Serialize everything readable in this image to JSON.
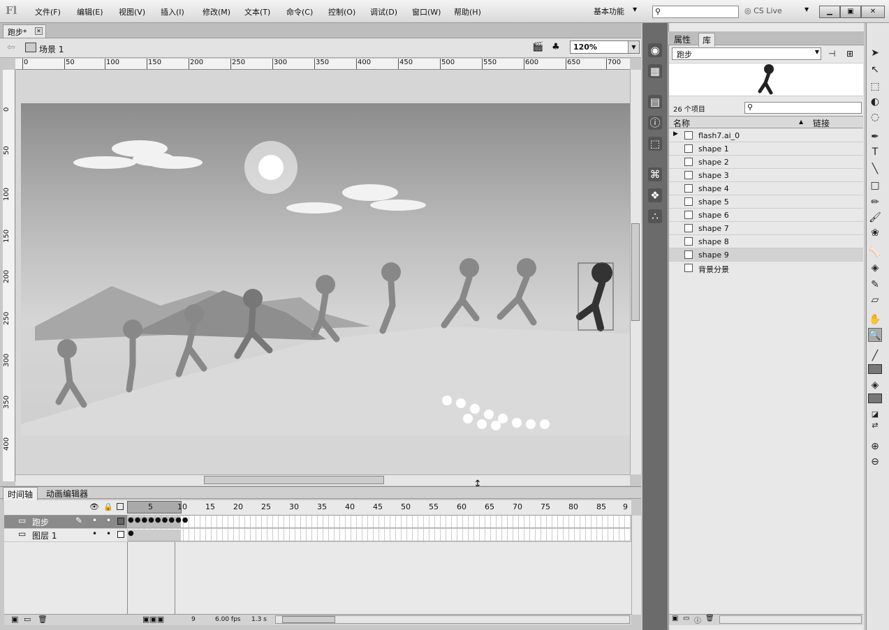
{
  "app": {
    "logo": "Fl"
  },
  "menu": [
    "文件(F)",
    "编辑(E)",
    "视图(V)",
    "插入(I)",
    "修改(M)",
    "文本(T)",
    "命令(C)",
    "控制(O)",
    "调试(D)",
    "窗口(W)",
    "帮助(H)"
  ],
  "topbar": {
    "workspace": "基本功能",
    "cs_live": "CS Live"
  },
  "document": {
    "tab_name": "跑步*",
    "scene": "场景 1",
    "zoom": "120%"
  },
  "ruler_h": [
    "0",
    "50",
    "100",
    "150",
    "200",
    "250",
    "300",
    "350",
    "400",
    "450",
    "500",
    "550",
    "600",
    "650",
    "700"
  ],
  "ruler_v": [
    "0",
    "50",
    "100",
    "150",
    "200",
    "250",
    "300",
    "350",
    "400"
  ],
  "timeline": {
    "tabs": [
      "时间轴",
      "动画编辑器"
    ],
    "frame_numbers": [
      "5",
      "10",
      "15",
      "20",
      "25",
      "30",
      "35",
      "40",
      "45",
      "50",
      "55",
      "60",
      "65",
      "70",
      "75",
      "80",
      "85",
      "9"
    ],
    "layers": [
      {
        "name": "跑步"
      },
      {
        "name": "图层 1"
      }
    ],
    "footer": {
      "frame": "9",
      "fps": "6.00 fps",
      "time": "1.3 s"
    }
  },
  "panel": {
    "tabs": [
      "属性",
      "库"
    ],
    "library_name": "跑步",
    "count": "26 个项目",
    "col_name": "名称",
    "col_link": "链接",
    "items": [
      "flash7.ai_0",
      "shape 1",
      "shape 2",
      "shape 3",
      "shape 4",
      "shape 5",
      "shape 6",
      "shape 7",
      "shape 8",
      "shape 9",
      "背景分景"
    ]
  }
}
